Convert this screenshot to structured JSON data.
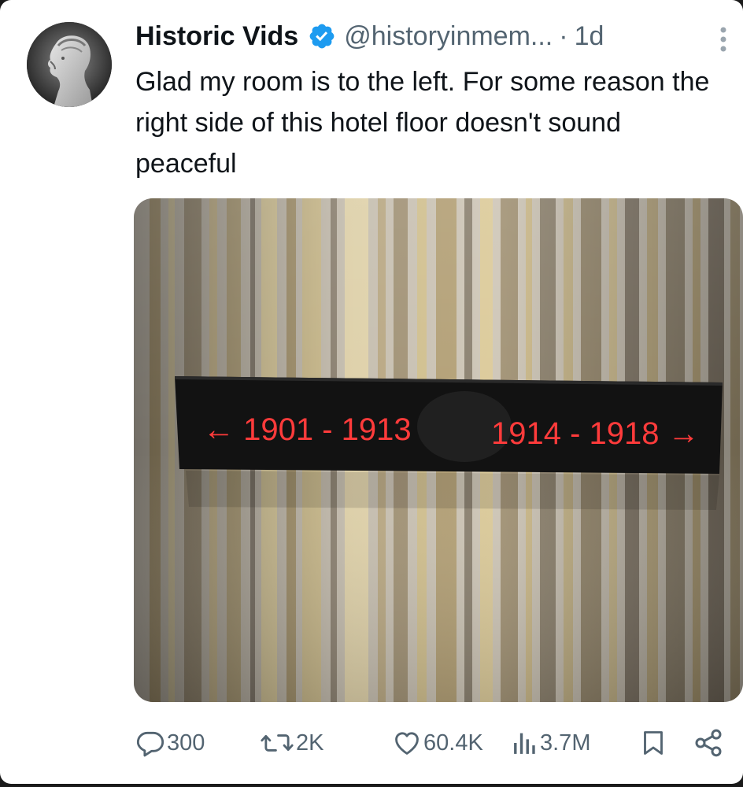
{
  "tweet": {
    "author": {
      "display_name": "Historic Vids",
      "handle": "@historyinmem...",
      "separator": "·",
      "time": "1d",
      "verified_icon": "verified-badge-icon",
      "verified_color": "#1d9bf0"
    },
    "text": "Glad my room is to the left. For some reason the right side of this hotel floor doesn't sound peaceful",
    "media": {
      "sign_left": "← 1901 - 1913",
      "sign_right": "1914 - 1918 →",
      "sign_text_color": "#ff3b3b"
    },
    "actions": {
      "replies": "300",
      "retweets": "2K",
      "likes": "60.4K",
      "views": "3.7M"
    }
  },
  "colors": {
    "text_primary": "#0f1419",
    "text_secondary": "#536471",
    "accent": "#1d9bf0"
  }
}
